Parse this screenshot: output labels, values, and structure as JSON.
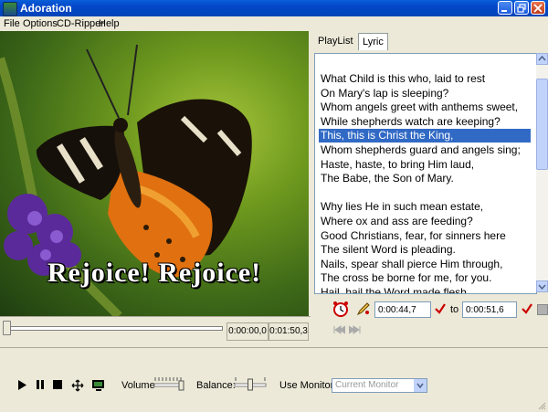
{
  "window": {
    "title": "Adoration"
  },
  "menu": [
    "File",
    "Options",
    "CD-Ripper",
    "Help"
  ],
  "video": {
    "caption": "Rejoice! Rejoice!"
  },
  "seek": {
    "position": 0.0,
    "current_time": "0:00:00,0",
    "total_time": "0:01:50,3"
  },
  "tabs": [
    {
      "label": "PlayList",
      "active": false
    },
    {
      "label": "Lyric",
      "active": true
    }
  ],
  "lyrics": {
    "lines": [
      "What Child is this who, laid to rest",
      "On Mary's lap is sleeping?",
      "Whom angels greet with anthems sweet,",
      "While shepherds watch are keeping?",
      "This, this is Christ the King,",
      "Whom shepherds guard and angels sing;",
      "Haste, haste, to bring Him laud,",
      "The Babe, the Son of Mary.",
      "",
      "Why lies He in such mean estate,",
      "Where ox and ass are feeding?",
      "Good Christians, fear, for sinners here",
      "The silent Word is pleading.",
      "Nails, spear shall pierce Him through,",
      "The cross be borne for me, for you.",
      "Hail, hail the Word made flesh,"
    ],
    "selected_index": 4
  },
  "sync": {
    "start": "0:00:44,7",
    "to_label": "to",
    "end": "0:00:51,6"
  },
  "controls": {
    "volume_label": "Volume",
    "balance_label": "Balance:",
    "monitor_label": "Use Monitor:",
    "monitor_value": "Current Monitor",
    "volume_level": 1.0,
    "balance_level": 0.5
  },
  "colors": {
    "titlebar": "#0346c8",
    "selection": "#316ac5",
    "check": "#cc0000"
  }
}
